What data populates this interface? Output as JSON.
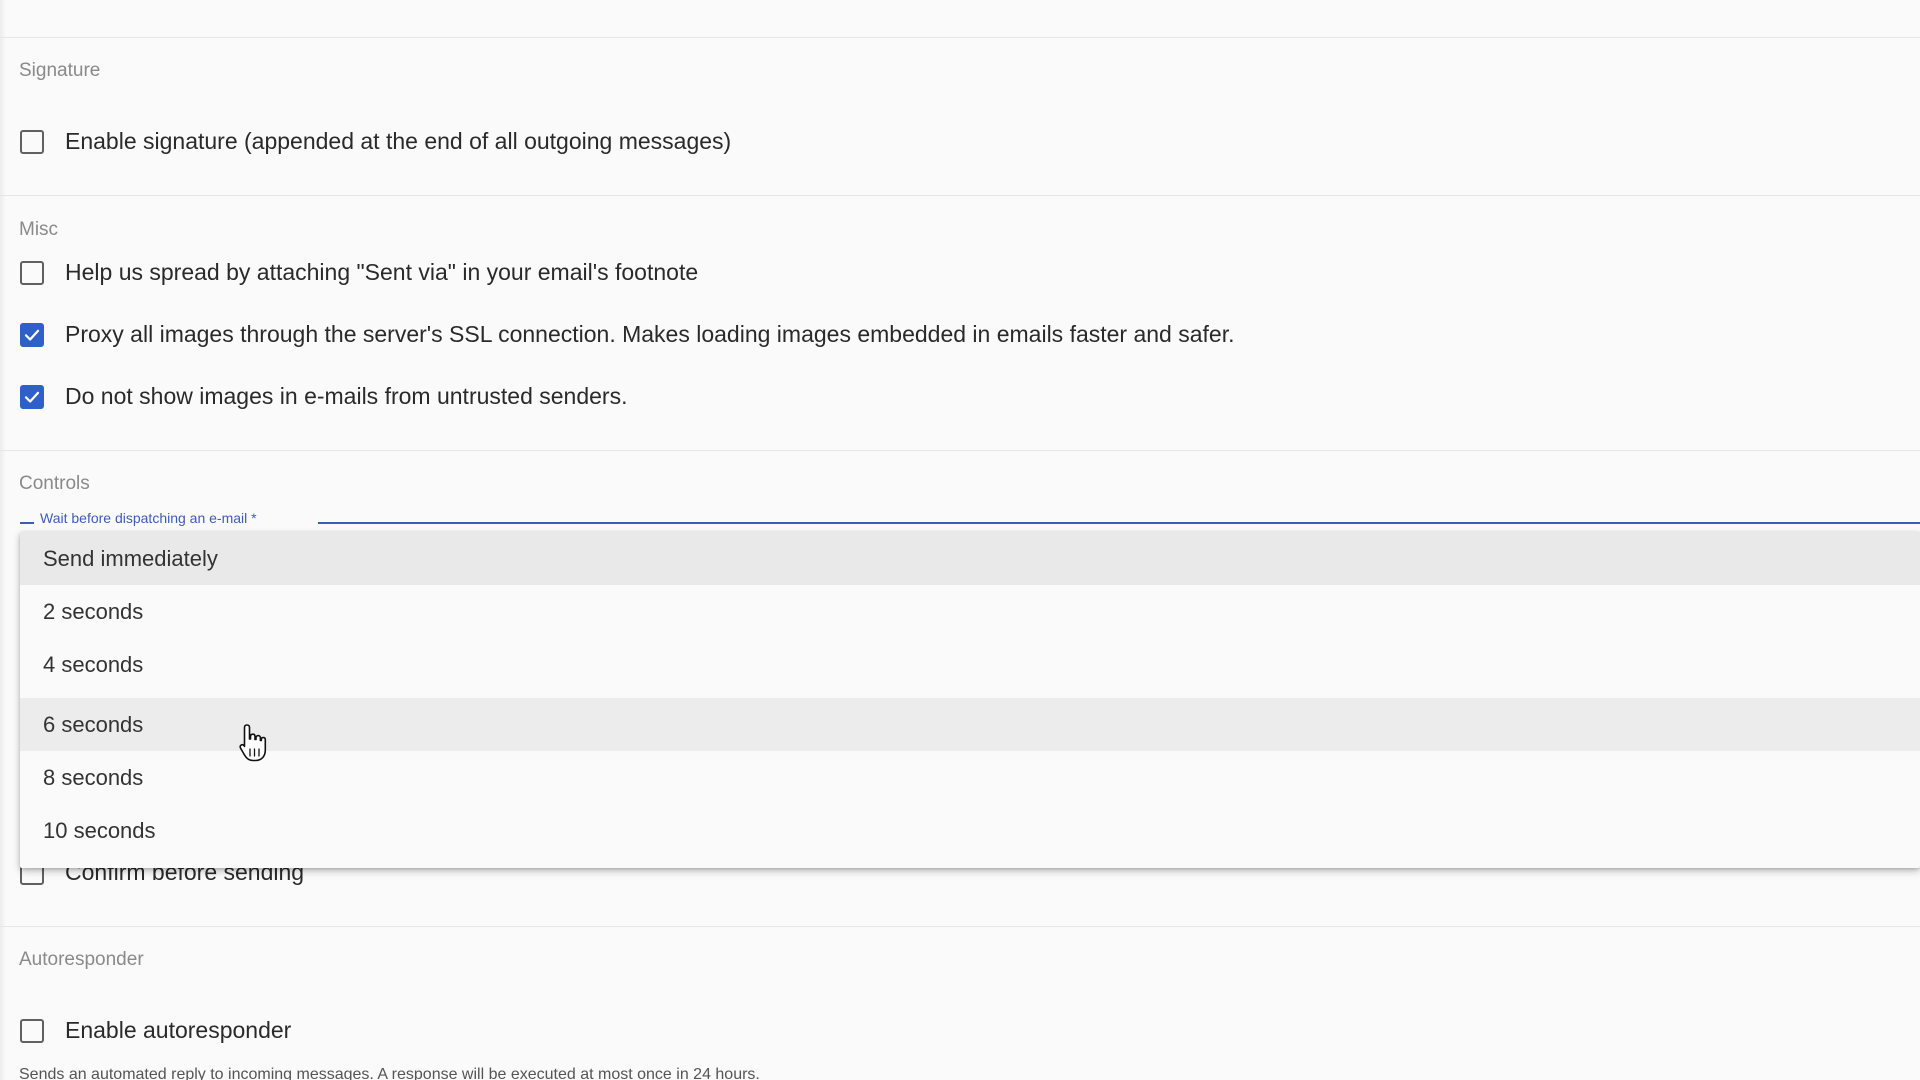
{
  "sections": {
    "signature": {
      "title": "Signature",
      "items": [
        {
          "label": "Enable signature (appended at the end of all outgoing messages)",
          "checked": false
        }
      ]
    },
    "misc": {
      "title": "Misc",
      "items": [
        {
          "label": "Help us spread by attaching \"Sent via\" in your email's footnote",
          "checked": false
        },
        {
          "label": "Proxy all images through the server's SSL connection. Makes loading images embedded in emails faster and safer.",
          "checked": true
        },
        {
          "label": "Do not show images in e-mails from untrusted senders.",
          "checked": true
        }
      ]
    },
    "controls": {
      "title": "Controls",
      "dispatch_field_label": "Wait before dispatching an e-mail *",
      "dispatch_options": [
        "Send immediately",
        "2 seconds",
        "4 seconds",
        "6 seconds",
        "8 seconds",
        "10 seconds"
      ],
      "selected_option": "Send immediately",
      "hovered_option": "6 seconds",
      "confirm_label": "Confirm before sending",
      "confirm_checked": false
    },
    "autoresponder": {
      "title": "Autoresponder",
      "enable_label": "Enable autoresponder",
      "enable_checked": false,
      "description": "Sends an automated reply to incoming messages. A response will be executed at most once in 24 hours."
    }
  },
  "colors": {
    "accent": "#2f5fc8",
    "section_title": "#8a8a8a",
    "checkbox_border": "#616161",
    "field_label": "#3f5bb8"
  },
  "icons": {
    "checkmark": "check-icon",
    "cursor": "hand-pointer-cursor-icon"
  }
}
